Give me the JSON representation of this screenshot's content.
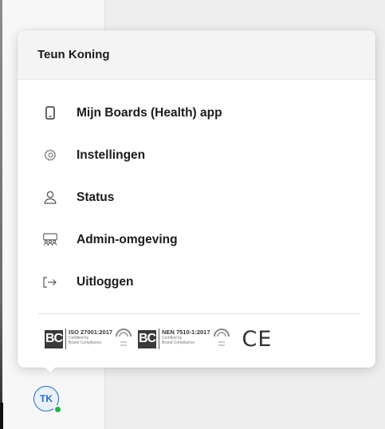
{
  "user": {
    "name": "Teun Koning",
    "initials": "TK",
    "status_color": "#22b14c"
  },
  "menu": {
    "items": [
      {
        "label": "Mijn Boards (Health) app",
        "icon": "phone-icon"
      },
      {
        "label": "Instellingen",
        "icon": "gear-icon"
      },
      {
        "label": "Status",
        "icon": "user-icon"
      },
      {
        "label": "Admin-omgeving",
        "icon": "users-icon"
      },
      {
        "label": "Uitloggen",
        "icon": "logout-icon"
      }
    ]
  },
  "certifications": [
    {
      "logo_text": "BC",
      "title": "ISO 27001:2017",
      "line1": "Certified by",
      "line2": "Brand Compliance"
    },
    {
      "logo_text": "BC",
      "title": "NEN 7510-1:2017",
      "line1": "Certified by",
      "line2": "Brand Compliance"
    }
  ],
  "ce_mark": "CE",
  "colors": {
    "accent": "#2a68c9",
    "text": "#1b1b1b",
    "header_bg": "#f4f4f5"
  }
}
